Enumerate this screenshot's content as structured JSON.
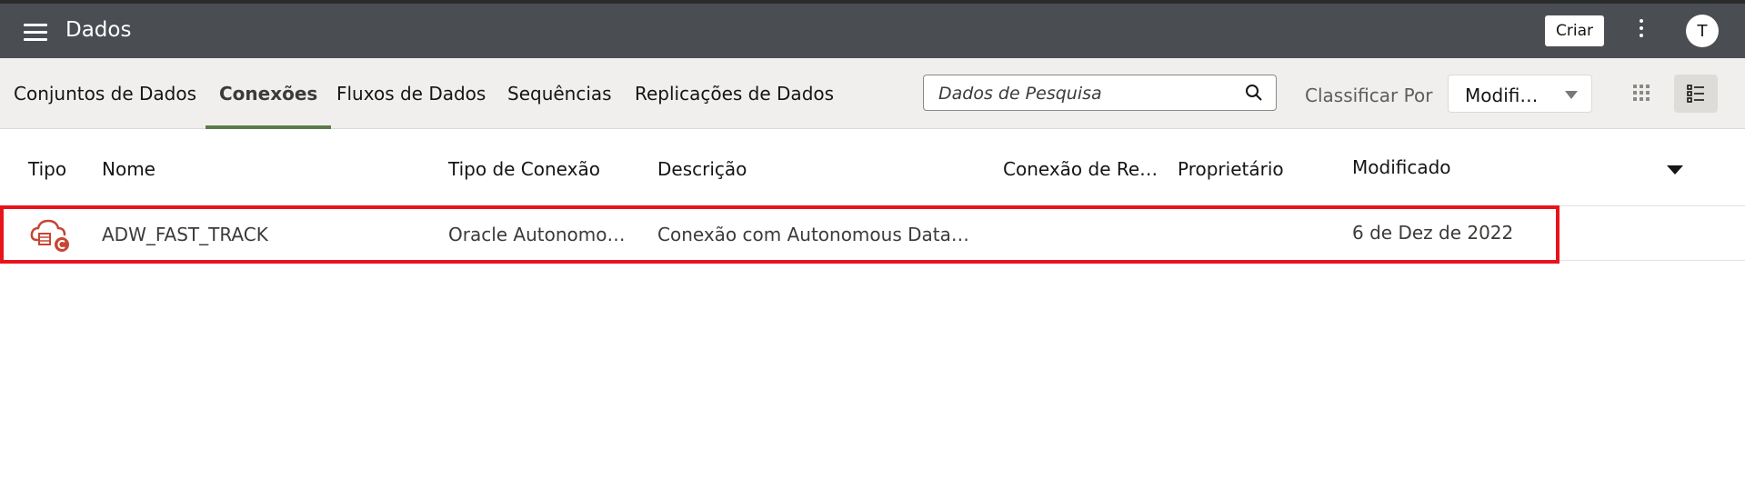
{
  "header": {
    "title": "Dados",
    "create_label": "Criar",
    "avatar_initial": "T"
  },
  "tabs": [
    {
      "label": "Conjuntos de Dados",
      "active": false
    },
    {
      "label": "Conexões",
      "active": true
    },
    {
      "label": "Fluxos de Dados",
      "active": false
    },
    {
      "label": "Sequências",
      "active": false
    },
    {
      "label": "Replicações de Dados",
      "active": false
    }
  ],
  "search": {
    "placeholder": "Dados de Pesquisa"
  },
  "sort": {
    "label": "Classificar Por",
    "value": "Modifi…"
  },
  "table": {
    "columns": [
      "Tipo",
      "Nome",
      "Tipo de Conexão",
      "Descrição",
      "Conexão de Re…",
      "Proprietário",
      "Modificado"
    ],
    "rows": [
      {
        "type_icon": "cloud-database-connection-icon",
        "name": "ADW_FAST_TRACK",
        "connection_type": "Oracle Autonomo…",
        "description": "Conexão com Autonomous Data …",
        "remote_connection": "",
        "owner": "",
        "modified": "6 de Dez de 2022"
      }
    ]
  },
  "colors": {
    "topbar": "#4a4d52",
    "tabbar": "#f1efed",
    "active_tab_underline": "#5b7a4a",
    "highlight_border": "#e8141b",
    "icon_red": "#c74634"
  }
}
